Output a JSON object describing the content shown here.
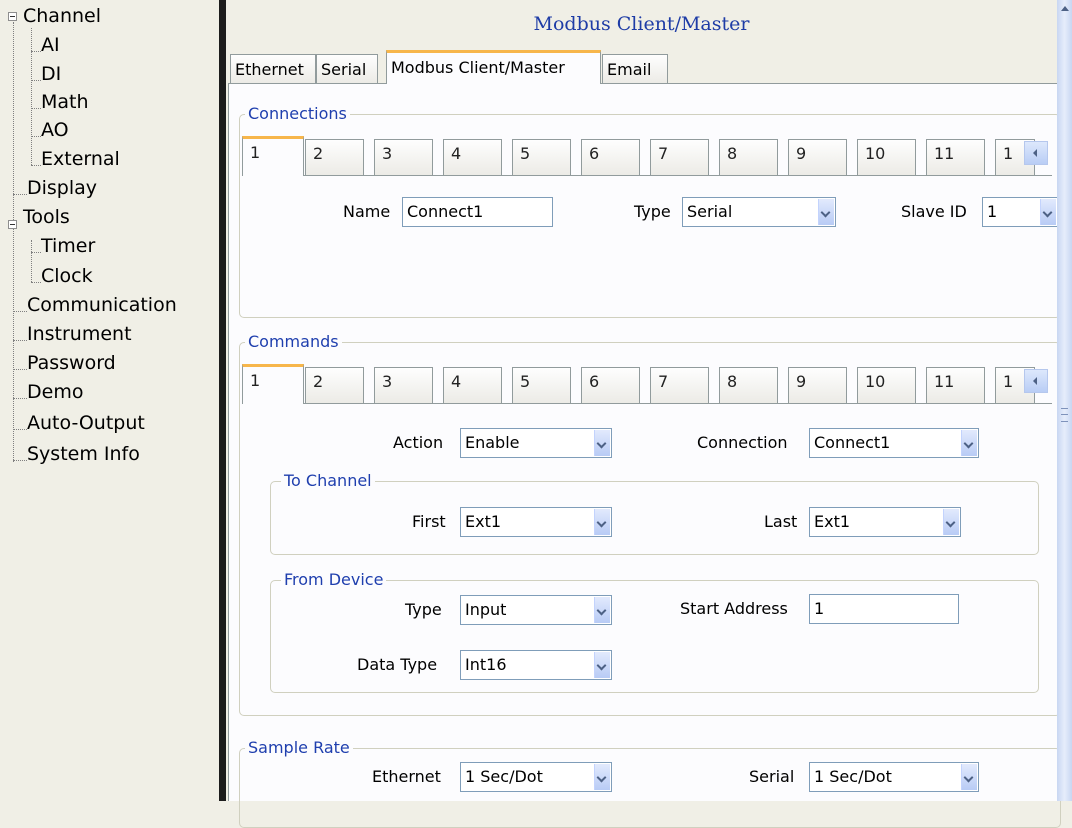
{
  "sidebar": {
    "items": [
      {
        "label": "Channel",
        "expandable": true
      },
      {
        "label": "AI"
      },
      {
        "label": "DI"
      },
      {
        "label": "Math"
      },
      {
        "label": "AO"
      },
      {
        "label": "External"
      },
      {
        "label": "Display"
      },
      {
        "label": "Tools",
        "expandable": true
      },
      {
        "label": "Timer"
      },
      {
        "label": "Clock"
      },
      {
        "label": "Communication"
      },
      {
        "label": "Instrument"
      },
      {
        "label": "Password"
      },
      {
        "label": "Demo"
      },
      {
        "label": "Auto-Output"
      },
      {
        "label": "System Info"
      }
    ]
  },
  "page": {
    "title": "Modbus Client/Master"
  },
  "top_tabs": [
    "Ethernet",
    "Serial",
    "Modbus Client/Master",
    "Email"
  ],
  "active_top_tab": "Modbus Client/Master",
  "connections": {
    "title": "Connections",
    "tabs": [
      "1",
      "2",
      "3",
      "4",
      "5",
      "6",
      "7",
      "8",
      "9",
      "10",
      "11",
      "1"
    ],
    "active_tab": "1",
    "name_label": "Name",
    "name_value": "Connect1",
    "type_label": "Type",
    "type_value": "Serial",
    "slave_label": "Slave ID",
    "slave_value": "1"
  },
  "commands": {
    "title": "Commands",
    "tabs": [
      "1",
      "2",
      "3",
      "4",
      "5",
      "6",
      "7",
      "8",
      "9",
      "10",
      "11",
      "1"
    ],
    "active_tab": "1",
    "action_label": "Action",
    "action_value": "Enable",
    "connection_label": "Connection",
    "connection_value": "Connect1",
    "to_channel": {
      "title": "To Channel",
      "first_label": "First",
      "first_value": "Ext1",
      "last_label": "Last",
      "last_value": "Ext1"
    },
    "from_device": {
      "title": "From Device",
      "type_label": "Type",
      "type_value": "Input",
      "start_label": "Start Address",
      "start_value": "1",
      "datatype_label": "Data Type",
      "datatype_value": "Int16"
    }
  },
  "sample_rate": {
    "title": "Sample Rate",
    "ethernet_label": "Ethernet",
    "ethernet_value": "1 Sec/Dot",
    "serial_label": "Serial",
    "serial_value": "1 Sec/Dot"
  },
  "colors": {
    "accent": "#1e3ca6",
    "tab_highlight": "#f7b64b",
    "divider": "#1c1c1c"
  },
  "icons": [
    "collapse-icon",
    "scroll-up-icon",
    "scroll-left-icon",
    "dropdown-arrow-icon"
  ]
}
